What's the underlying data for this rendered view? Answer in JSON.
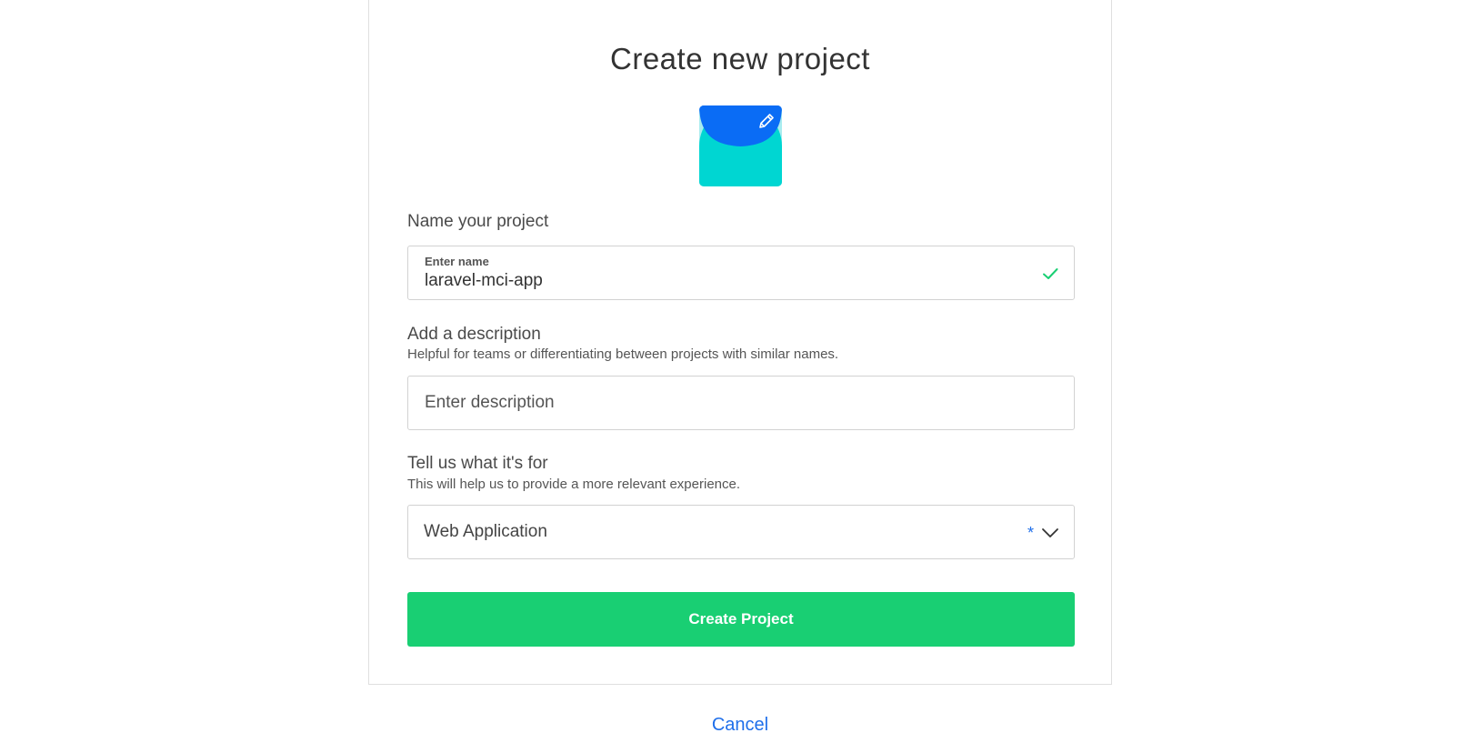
{
  "page": {
    "title": "Create new project",
    "cancel_label": "Cancel"
  },
  "project_icon": {
    "top_color": "#0a6cf5",
    "bottom_color": "#00d6d2",
    "background_color": "#a9ecef",
    "edit_icon": "pencil-icon"
  },
  "name_section": {
    "label": "Name your project",
    "field_label": "Enter name",
    "value": "laravel-mci-app",
    "status_icon": "check-icon",
    "status_color": "#19cf73"
  },
  "description_section": {
    "label": "Add a description",
    "helper": "Helpful for teams or differentiating between projects with similar names.",
    "placeholder": "Enter description",
    "value": ""
  },
  "purpose_section": {
    "label": "Tell us what it's for",
    "helper": "This will help us to provide a more relevant experience.",
    "selected": "Web Application",
    "required_mark": "*",
    "dropdown_icon": "chevron-down-icon"
  },
  "actions": {
    "create_label": "Create Project",
    "create_color": "#19cf73"
  }
}
